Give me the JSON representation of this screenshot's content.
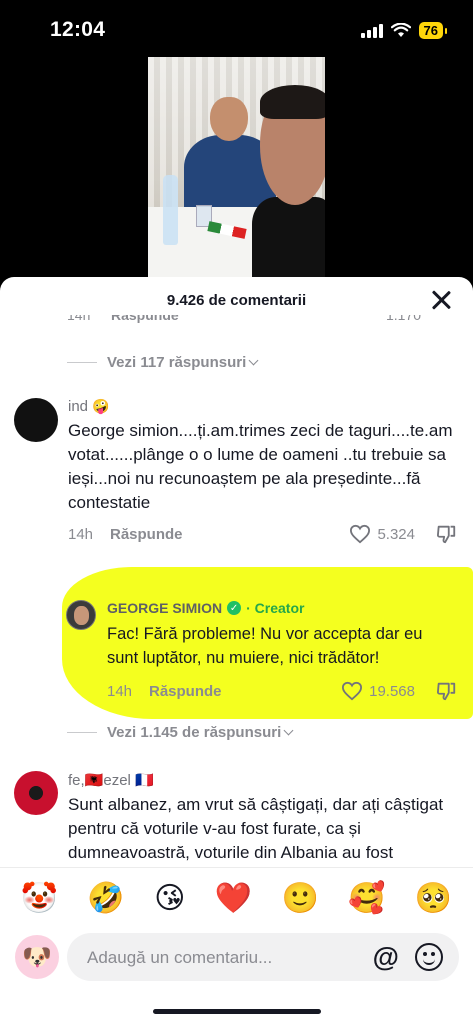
{
  "status_bar": {
    "time": "12:04",
    "battery": "76"
  },
  "sheet": {
    "title": "9.426 de comentarii"
  },
  "partial_row": {
    "time": "14h",
    "reply": "Răspunde",
    "likes": "1.170"
  },
  "view_replies_1": "Vezi 117 răspunsuri",
  "comment1": {
    "username": "ind",
    "username_emoji": "🤪",
    "text": "George simion....ți.am.trimes zeci de taguri....te.am votat......plânge o o lume de oameni ..tu trebuie sa ieși...noi nu recunoaștem pe ala președinte...fă contestatie",
    "time": "14h",
    "reply": "Răspunde",
    "likes": "5.324"
  },
  "creator_reply": {
    "username": "GEORGE SIMION",
    "badge": "· Creator",
    "text": "Fac! Fără probleme! Nu vor accepta dar eu sunt luptător, nu muiere, nici trădător!",
    "time": "14h",
    "reply": "Răspunde",
    "likes": "19.568"
  },
  "view_replies_2": "Vezi 1.145 de răspunsuri",
  "comment2": {
    "username": "fe,🇦🇱ezel 🇫🇷",
    "text": "Sunt albanez, am vrut să câștigați, dar ați câștigat pentru că voturile v-au fost furate, ca și dumneavoastră, voturile din Albania au fost"
  },
  "emoji_bar": [
    "🤡",
    "🤣",
    "😘",
    "❤️",
    "🙂",
    "🥰",
    "🥺"
  ],
  "input": {
    "placeholder": "Adaugă un comentariu...",
    "at": "@"
  },
  "colors": {
    "highlight": "#f4ff1f",
    "creator": "#25a74a",
    "muted": "#8a8b91"
  }
}
